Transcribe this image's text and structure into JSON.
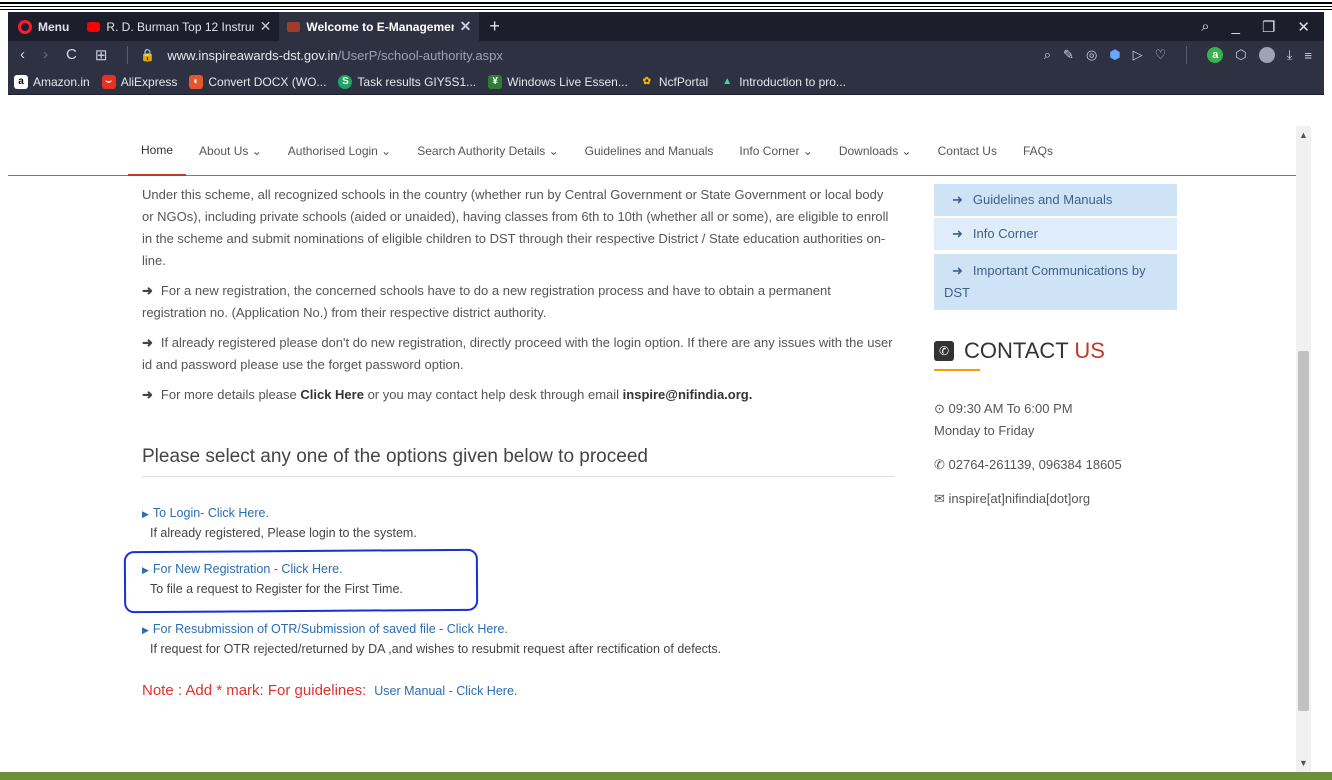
{
  "browser": {
    "menu_label": "Menu",
    "tabs": [
      {
        "title": "R. D. Burman Top 12 Instrum",
        "close": "✕",
        "active": false
      },
      {
        "title": "Welcome to E-Managemen",
        "close": "✕",
        "active": true
      }
    ],
    "new_tab": "+",
    "window_controls": {
      "search": "⌕",
      "minimize": "_",
      "restore": "❐",
      "close": "✕"
    },
    "nav": {
      "back": "‹",
      "forward": "›",
      "reload": "C",
      "tabs_grid": "⊞"
    },
    "url_host": "www.inspireawards-dst.gov.in",
    "url_path": "/UserP/school-authority.aspx",
    "bookmarks": [
      {
        "label": "Amazon.in",
        "icon": "amazon-icon",
        "color": "#ffffff",
        "glyph": "a"
      },
      {
        "label": "AliExpress",
        "icon": "aliexpress-icon",
        "color": "#e43225",
        "glyph": "⌣"
      },
      {
        "label": "Convert DOCX (WO...",
        "icon": "convert-icon",
        "color": "#e4572e",
        "glyph": "◐"
      },
      {
        "label": "Task results GIY5S1...",
        "icon": "task-icon",
        "color": "#1fa463",
        "glyph": "S"
      },
      {
        "label": "Windows Live Essen...",
        "icon": "windows-live-icon",
        "color": "#2e7d32",
        "glyph": "¥"
      },
      {
        "label": "NcfPortal",
        "icon": "ncf-icon",
        "color": "#f4b400",
        "glyph": "✿"
      },
      {
        "label": "Introduction to pro...",
        "icon": "android-icon",
        "color": "#3ddc84",
        "glyph": "▲"
      }
    ]
  },
  "site_nav": [
    "Home",
    "About Us ⌄",
    "Authorised Login ⌄",
    "Search Authority Details ⌄",
    "Guidelines and Manuals",
    "Info Corner ⌄",
    "Downloads ⌄",
    "Contact Us",
    "FAQs"
  ],
  "main": {
    "intro": "Under this scheme, all recognized schools in the country (whether run by Central Government or State Government or local body or NGOs), including private schools (aided or unaided), having classes from 6th to 10th (whether all or some), are eligible to enroll in the scheme and submit nominations of eligible children to DST through their respective District / State education authorities on-line.",
    "point1": "For a new registration, the concerned schools have to do a new registration process and have to obtain a permanent registration no. (Application No.) from their respective district authority.",
    "point2": "If already registered please don't do new registration, directly proceed with the login option. If there are any issues with the user id and password please use the forget password option.",
    "point3_pre": "For more details please ",
    "point3_link": "Click Here",
    "point3_mid": " or you may contact help desk through email ",
    "point3_email": "inspire@nifindia.org.",
    "select_heading": "Please select any one of the options given below to proceed",
    "options": [
      {
        "link": "To Login- Click Here.",
        "desc": "If already registered, Please login to the system."
      },
      {
        "link": "For New Registration - Click Here.",
        "desc": "To file a request to Register for the First Time."
      },
      {
        "link": "For Resubmission of OTR/Submission of saved file - Click Here.",
        "desc": "If request for OTR rejected/returned by DA ,and wishes to resubmit request after rectification of defects."
      }
    ],
    "note": "Note : Add * mark: For guidelines:",
    "note_link": "User Manual - Click Here."
  },
  "sidebar": {
    "items": [
      "Guidelines and Manuals",
      "Info Corner",
      "Important Communications by DST"
    ],
    "contact_title_a": "CONTACT ",
    "contact_title_b": "US",
    "hours": "⊙ 09:30 AM To 6:00 PM",
    "days": "Monday to Friday",
    "phone": "✆ 02764-261139, 096384 18605",
    "email": "✉ inspire[at]nifindia[dot]org"
  }
}
